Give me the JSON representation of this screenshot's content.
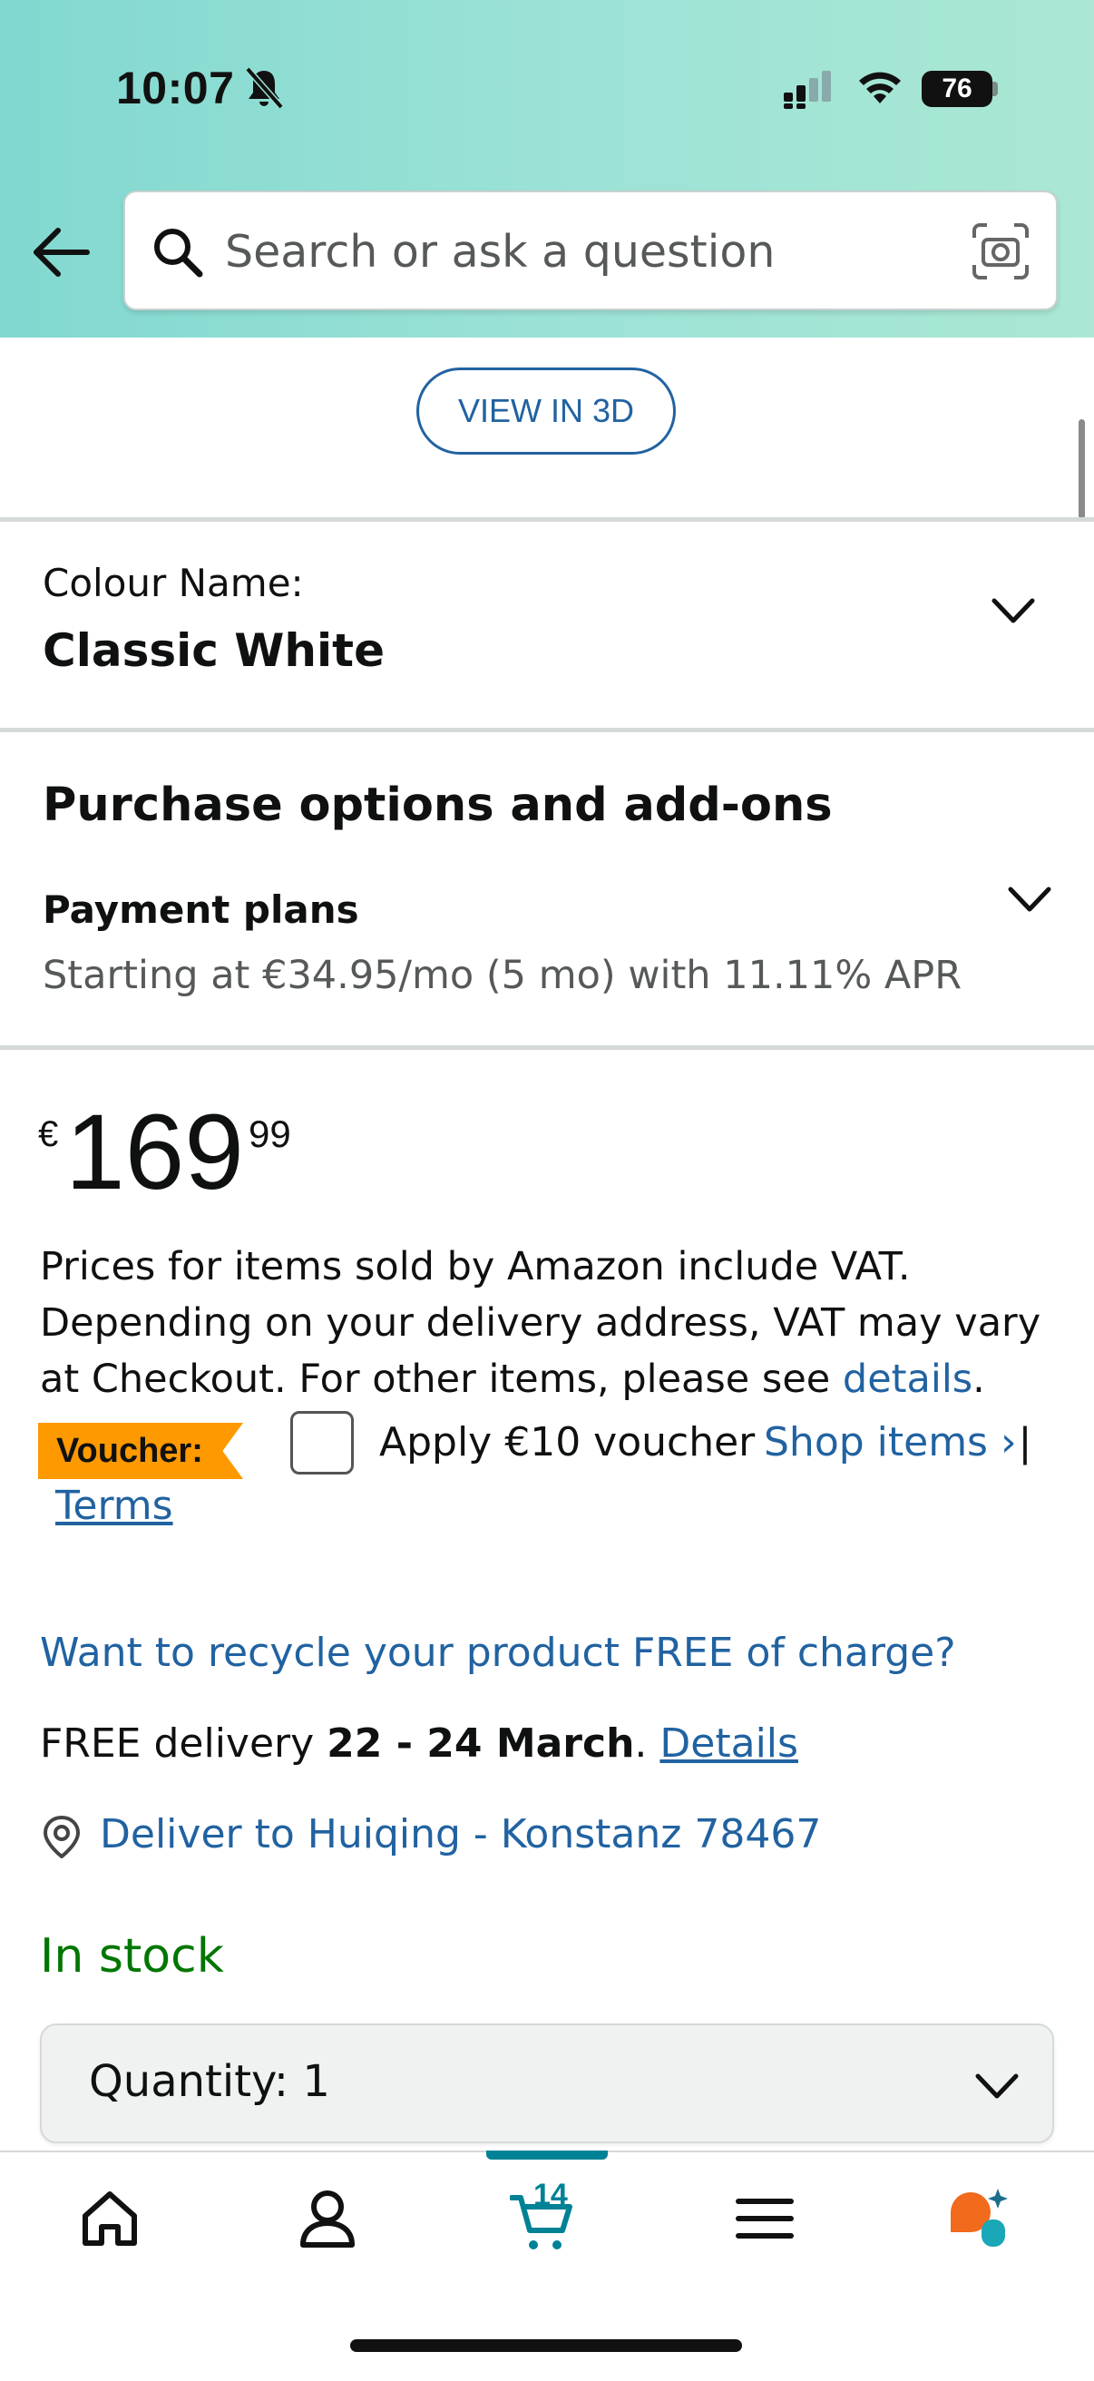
{
  "status_bar": {
    "time": "10:07",
    "battery": "76"
  },
  "search": {
    "placeholder": "Search or ask a question"
  },
  "view3d": {
    "label": "VIEW IN 3D"
  },
  "colour": {
    "label": "Colour Name:",
    "value": "Classic White"
  },
  "purchase": {
    "title": "Purchase options and add-ons",
    "payment_title": "Payment plans",
    "payment_sub": "Starting at €34.95/mo (5 mo) with 11.11% APR"
  },
  "price": {
    "currency": "€",
    "whole": "169",
    "fraction": "99"
  },
  "vat": {
    "text": "Prices for items sold by Amazon include VAT. Depending on your delivery address, VAT may vary at Checkout. For other items, please see ",
    "link": "details",
    "end": "."
  },
  "voucher": {
    "badge": "Voucher:",
    "apply": "Apply €10 voucher",
    "shop": "Shop items ›",
    "pipe": "|",
    "terms": "Terms"
  },
  "recycle": "Want to recycle your product FREE of charge?",
  "delivery": {
    "prefix": "FREE delivery ",
    "dates": "22 - 24 March",
    "sep": ". ",
    "details": "Details"
  },
  "deliver_to": "Deliver to Huiqing - Konstanz 78467",
  "stock": "In stock",
  "quantity": {
    "label": "Quantity:  1"
  },
  "nav": {
    "cart_count": "14"
  },
  "colors": {
    "link": "#2162a1",
    "stock": "#007600",
    "voucher": "#ff9900",
    "cart": "#008296"
  }
}
